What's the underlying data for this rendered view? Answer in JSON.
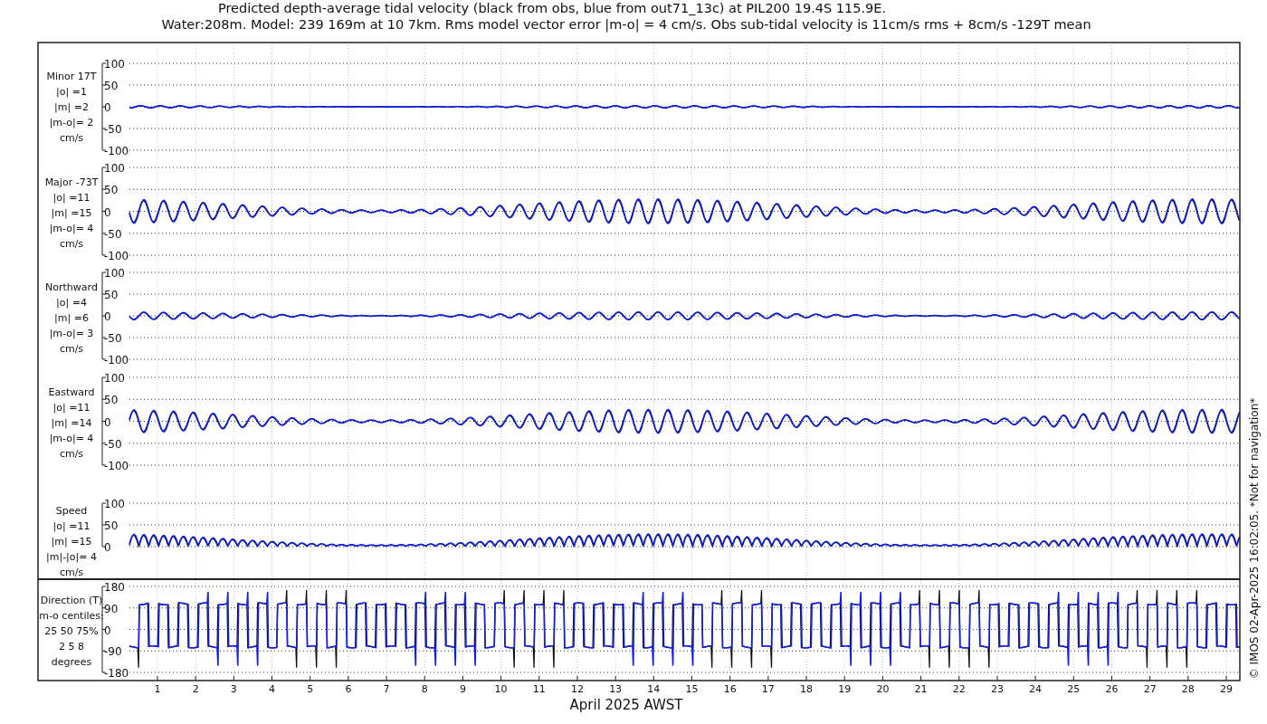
{
  "title_lines": [
    "Predicted depth-average tidal velocity (black from obs, blue from out71_13c) at PIL200 19.4S 115.9E.",
    "Water:208m. Model: 239 169m at 10 7km. Rms model vector error |m-o| = 4 cm/s. Obs sub-tidal velocity is 11cm/s rms + 8cm/s -129T mean"
  ],
  "panels": [
    {
      "kind": "minor",
      "label_lines": [
        "Minor 17T",
        "|o| =1",
        "|m| =2",
        "|m-o|= 2",
        "cm/s"
      ],
      "yticks": [
        "100",
        "50",
        "0",
        "-50",
        "-100"
      ]
    },
    {
      "kind": "major",
      "label_lines": [
        "Major -73T",
        "|o| =11",
        "|m| =15",
        "|m-o|= 4",
        "cm/s"
      ],
      "yticks": [
        "100",
        "50",
        "0",
        "-50",
        "-100"
      ]
    },
    {
      "kind": "north",
      "label_lines": [
        "Northward",
        "|o| =4",
        "|m| =6",
        "|m-o|= 3",
        "cm/s"
      ],
      "yticks": [
        "100",
        "50",
        "0",
        "-50",
        "-100"
      ]
    },
    {
      "kind": "east",
      "label_lines": [
        "Eastward",
        "|o| =11",
        "|m| =14",
        "|m-o|= 4",
        "cm/s"
      ],
      "yticks": [
        "100",
        "50",
        "0",
        "-50",
        "-100"
      ]
    },
    {
      "kind": "speed",
      "label_lines": [
        "Speed",
        "|o| =11",
        "|m| =15",
        "|m|-|o|= 4",
        "cm/s"
      ],
      "yticks": [
        "100",
        "50",
        "0"
      ]
    },
    {
      "kind": "direction",
      "label_lines": [
        "Direction (T)",
        "m-o centiles:",
        "25  50  75%",
        "2  5  8",
        "degrees"
      ],
      "yticks": [
        "180",
        "90",
        "0",
        "-90",
        "-180"
      ]
    }
  ],
  "xticks": [
    "1",
    "2",
    "3",
    "4",
    "5",
    "6",
    "7",
    "8",
    "9",
    "10",
    "11",
    "12",
    "13",
    "14",
    "15",
    "16",
    "17",
    "18",
    "19",
    "20",
    "21",
    "22",
    "23",
    "24",
    "25",
    "26",
    "27",
    "28",
    "29"
  ],
  "xlabel": "April 2025 AWST",
  "side_note": "© IMOS 02-Apr-2025 16:02:05. *Not for navigation*"
}
